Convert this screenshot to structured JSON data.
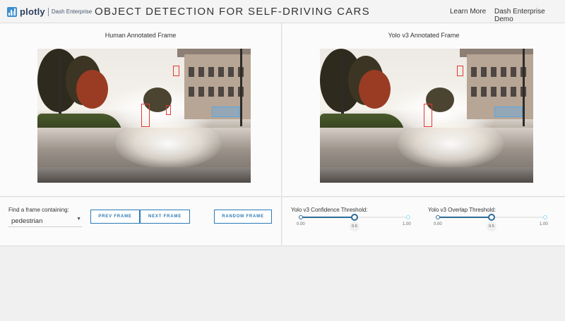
{
  "header": {
    "logo_text": "plotly",
    "logo_subtext": "Dash Enterprise",
    "title": "OBJECT DETECTION FOR SELF-DRIVING CARS",
    "links": [
      {
        "label": "Learn More"
      },
      {
        "label": "Dash Enterprise Demo"
      }
    ]
  },
  "frames": {
    "left_title": "Human Annotated Frame",
    "right_title": "Yolo v3 Annotated Frame"
  },
  "controls": {
    "find_label": "Find a frame containing:",
    "dropdown_value": "pedestrian",
    "prev_label": "PREV FRAME",
    "next_label": "NEXT FRAME",
    "random_label": "RANDOM FRAME"
  },
  "sliders": [
    {
      "label": "Yolo v3 Confidence Threshold:",
      "min_label": "0.00",
      "max_label": "1.00",
      "value": 0.5,
      "value_label": "0.5"
    },
    {
      "label": "Yolo v3 Overlap Threshold:",
      "min_label": "0.00",
      "max_label": "1.00",
      "value": 0.5,
      "value_label": "0.5"
    }
  ],
  "colors": {
    "accent": "#2c7bb6",
    "slider_track": "#2c6b98",
    "box_red": "#e23a2f",
    "box_blue": "#5ca8e0"
  },
  "icons": {
    "logo": "plotly-bars-icon",
    "dropdown": "caret-down-icon"
  }
}
